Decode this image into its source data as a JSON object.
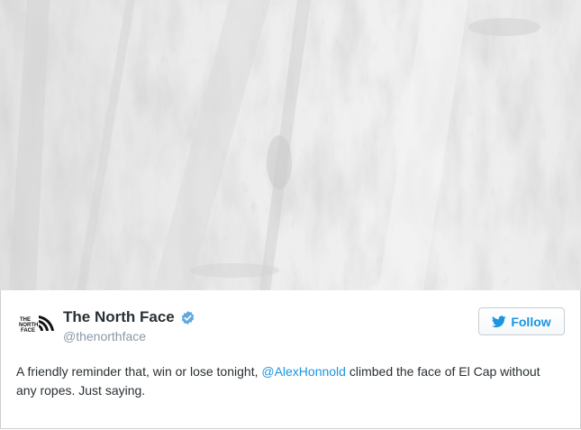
{
  "photo": {
    "description_icon": "el-capitan-rock-face-image"
  },
  "tweet": {
    "author": {
      "name": "The North Face",
      "handle": "@thenorthface",
      "verified": true,
      "logo_text": [
        "THE",
        "NORTH",
        "FACE"
      ]
    },
    "follow_label": "Follow",
    "text_before": "A friendly reminder that, win or lose tonight, ",
    "mention": "@AlexHonnold",
    "text_after": " climbed the face of El Cap without any ropes. Just saying."
  },
  "colors": {
    "accent": "#1b95e0",
    "verified": "#5fa9dd",
    "text": "#292f33",
    "muted": "#8899a6"
  }
}
